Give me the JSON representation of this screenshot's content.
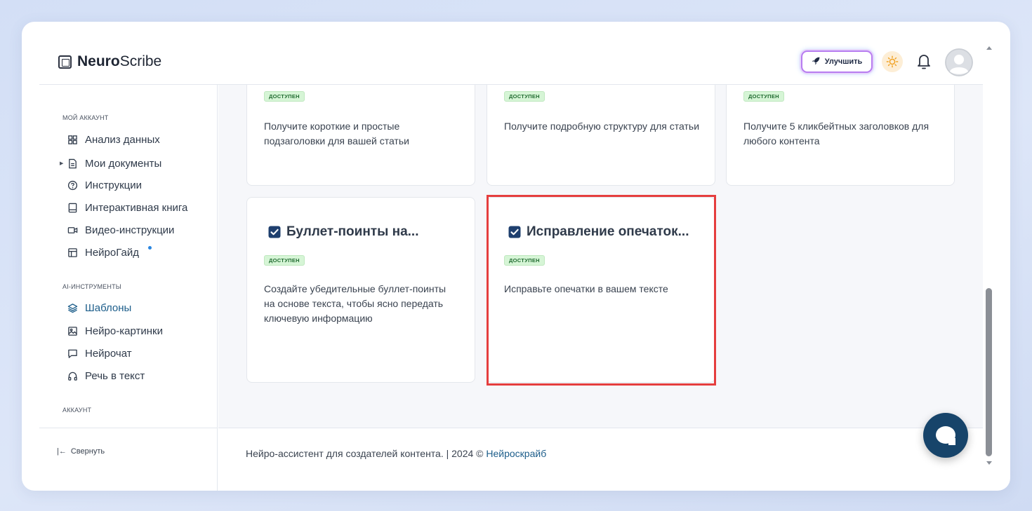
{
  "header": {
    "logo_bold": "Neuro",
    "logo_regular": "Scribe",
    "upgrade_label": "Улучшить"
  },
  "sidebar": {
    "section_account": "МОЙ АККАУНТ",
    "account_items": [
      {
        "label": "Анализ данных",
        "icon": "grid-icon"
      },
      {
        "label": "Мои документы",
        "icon": "document-icon"
      },
      {
        "label": "Инструкции",
        "icon": "help-icon"
      },
      {
        "label": "Интерактивная книга",
        "icon": "book-icon"
      },
      {
        "label": "Видео-инструкции",
        "icon": "video-icon"
      },
      {
        "label": "НейроГайд",
        "icon": "guide-icon"
      }
    ],
    "section_ai": "AI-ИНСТРУМЕНТЫ",
    "ai_items": [
      {
        "label": "Шаблоны",
        "icon": "layers-icon"
      },
      {
        "label": "Нейро-картинки",
        "icon": "image-icon"
      },
      {
        "label": "Нейрочат",
        "icon": "chat-icon"
      },
      {
        "label": "Речь в текст",
        "icon": "headphones-icon"
      }
    ],
    "section_acc": "АККАУНТ",
    "collapse_label": "Свернуть"
  },
  "cards_top": [
    {
      "badge": "доступен",
      "desc": "Получите короткие и простые подзаголовки для вашей статьи"
    },
    {
      "badge": "доступен",
      "desc": "Получите подробную структуру для статьи"
    },
    {
      "badge": "доступен",
      "desc": "Получите 5 кликбейтных заголовков для любого контента"
    }
  ],
  "cards_bottom": [
    {
      "title": "Буллет-поинты на...",
      "badge": "доступен",
      "desc": "Создайте убедительные буллет-поинты на основе текста, чтобы ясно передать ключевую информацию"
    },
    {
      "title": "Исправление опечаток...",
      "badge": "доступен",
      "desc": "Исправьте опечатки в вашем тексте"
    }
  ],
  "footer": {
    "text": "Нейро-ассистент для создателей контента.  | 2024 © ",
    "link": "Нейроскрайб"
  },
  "colors": {
    "accent": "#1c5d8a",
    "badge_bg": "#d6f5d6",
    "highlight": "#e53e3e",
    "chat_button": "#17446a"
  }
}
